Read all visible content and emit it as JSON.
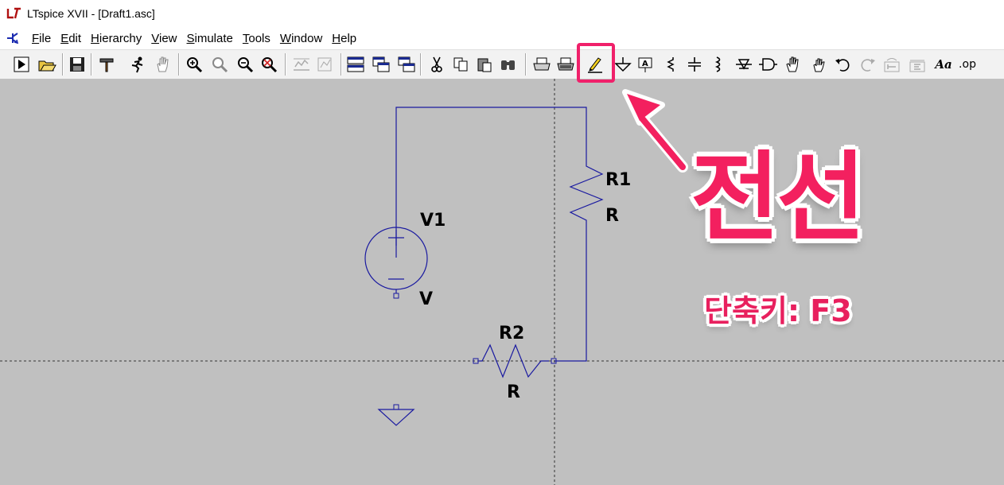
{
  "window": {
    "title": "LTspice XVII - [Draft1.asc]"
  },
  "menu": {
    "items": [
      {
        "label": "File",
        "accel": "F",
        "rest": "ile"
      },
      {
        "label": "Edit",
        "accel": "E",
        "rest": "dit"
      },
      {
        "label": "Hierarchy",
        "accel": "H",
        "rest": "ierarchy"
      },
      {
        "label": "View",
        "accel": "V",
        "rest": "iew"
      },
      {
        "label": "Simulate",
        "accel": "S",
        "rest": "imulate"
      },
      {
        "label": "Tools",
        "accel": "T",
        "rest": "ools"
      },
      {
        "label": "Window",
        "accel": "W",
        "rest": "indow"
      },
      {
        "label": "Help",
        "accel": "H",
        "rest": "elp"
      }
    ]
  },
  "toolbar": {
    "font_button_label": "Aa",
    "spice_directive_label": ".op"
  },
  "schematic": {
    "components": [
      {
        "ref": "V1",
        "value": "V",
        "type": "voltage-source"
      },
      {
        "ref": "R1",
        "value": "R",
        "type": "resistor"
      },
      {
        "ref": "R2",
        "value": "R",
        "type": "resistor"
      }
    ],
    "wire_color": "#1a1aa0",
    "canvas_color": "#c0c0c0"
  },
  "annotation": {
    "title": "전선",
    "shortcut": "단축키: F3",
    "color": "#f3205f"
  }
}
